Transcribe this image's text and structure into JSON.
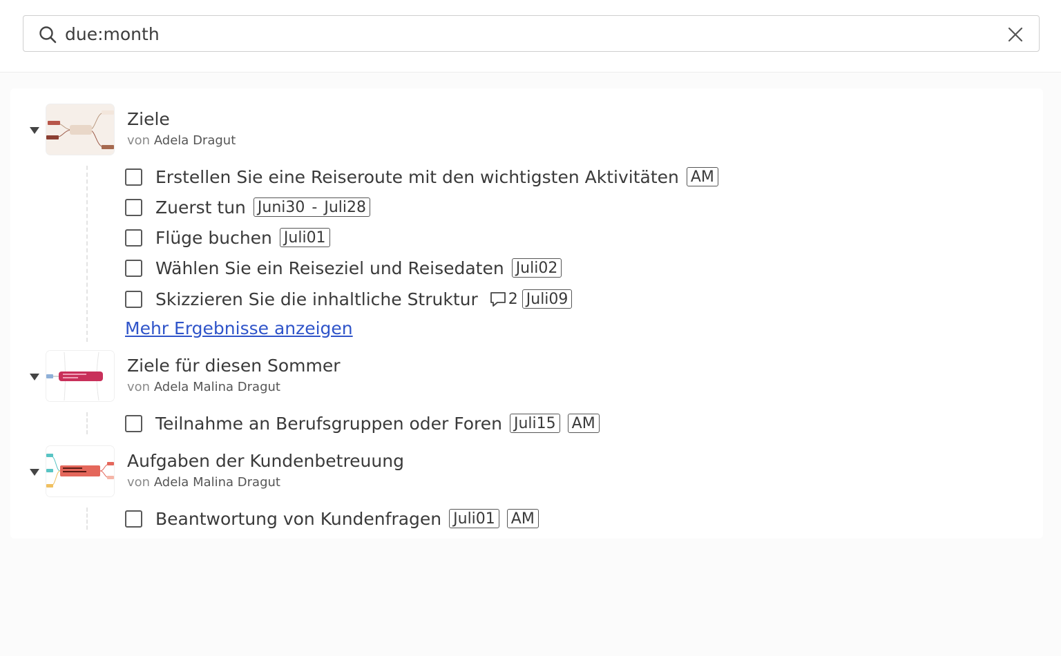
{
  "search": {
    "value": "due:month",
    "placeholder": ""
  },
  "groups": [
    {
      "title": "Ziele",
      "author_prefix": "von",
      "author": "Adela Dragut",
      "tasks": [
        {
          "text": "Erstellen Sie eine Reiseroute mit den wichtigsten Aktivitäten",
          "tags": [
            "AM"
          ]
        },
        {
          "text": "Zuerst tun",
          "date_from": "Juni30",
          "date_sep": "-",
          "date_to": "Juli28"
        },
        {
          "text": "Flüge buchen",
          "tags": [
            "Juli01"
          ]
        },
        {
          "text": "Wählen Sie ein Reiseziel und Reisedaten",
          "tags": [
            "Juli02"
          ]
        },
        {
          "text": "Skizzieren Sie die inhaltliche Struktur",
          "comments": "2",
          "tags": [
            "Juli09"
          ]
        }
      ],
      "more_link": "Mehr Ergebnisse anzeigen"
    },
    {
      "title": "Ziele für diesen Sommer",
      "author_prefix": "von",
      "author": "Adela Malina Dragut",
      "tasks": [
        {
          "text": "Teilnahme an Berufsgruppen oder Foren",
          "tags": [
            "Juli15",
            "AM"
          ]
        }
      ]
    },
    {
      "title": "Aufgaben der Kundenbetreuung",
      "author_prefix": "von",
      "author": "Adela Malina Dragut",
      "tasks": [
        {
          "text": "Beantwortung von Kundenfragen",
          "tags": [
            "Juli01",
            "AM"
          ]
        }
      ]
    }
  ],
  "icons": {
    "search": "search-icon",
    "clear": "close-icon",
    "collapse": "caret-down-icon",
    "comment": "comment-icon"
  },
  "colors": {
    "link": "#2f54c9",
    "thumb1_center": "#e9d7c8",
    "thumb2_center": "#c8305a",
    "thumb3_center": "#e4675b"
  }
}
